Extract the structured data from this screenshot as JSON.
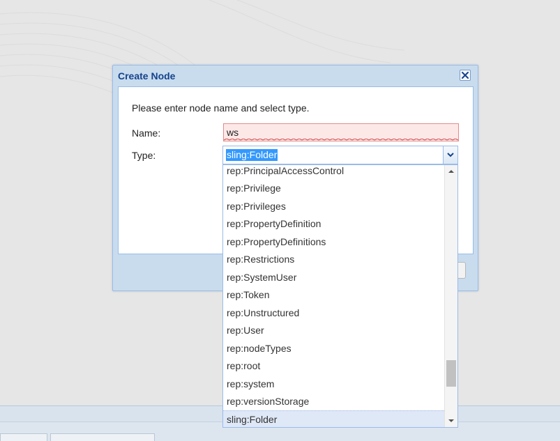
{
  "dialog": {
    "title": "Create Node",
    "prompt": "Please enter node name and select type.",
    "name_label": "Name:",
    "type_label": "Type:",
    "name_value": "ws",
    "type_value": "sling:Folder"
  },
  "dropdown": {
    "items": [
      "rep:PrincipalAccessControl",
      "rep:Privilege",
      "rep:Privileges",
      "rep:PropertyDefinition",
      "rep:PropertyDefinitions",
      "rep:Restrictions",
      "rep:SystemUser",
      "rep:Token",
      "rep:Unstructured",
      "rep:User",
      "rep:nodeTypes",
      "rep:root",
      "rep:system",
      "rep:versionStorage",
      "sling:Folder"
    ],
    "selected": "sling:Folder"
  },
  "colors": {
    "title": "#15428b",
    "dialog_frame": "#c8dcee",
    "invalid_bg": "#fde8e8",
    "selection": "#3399ff"
  },
  "icons": {
    "close": "close-icon",
    "combo_trigger": "chevron-down-icon",
    "scroll_up": "arrow-up-icon",
    "scroll_down": "arrow-down-icon"
  }
}
